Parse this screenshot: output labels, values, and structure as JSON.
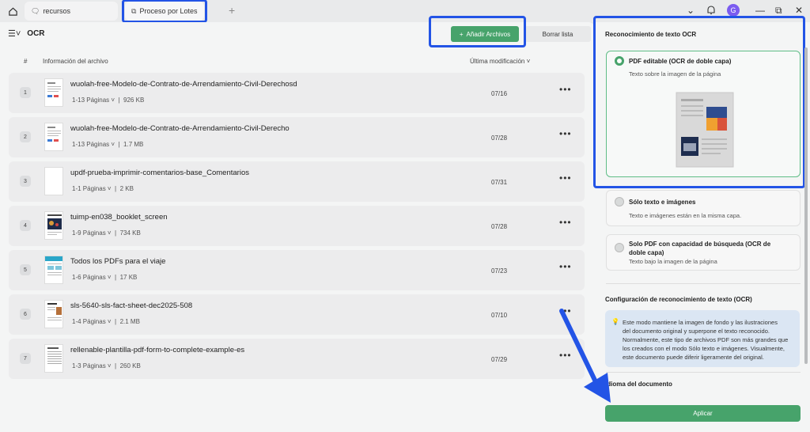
{
  "titlebar": {
    "tabs": [
      {
        "label": "recursos"
      },
      {
        "label": "Proceso por Lotes"
      }
    ],
    "avatar_letter": "G"
  },
  "toolbar": {
    "title": "OCR",
    "add_files": "Añadir Archivos",
    "clear_list": "Borrar lista"
  },
  "columns": {
    "number": "#",
    "info": "Información del archivo",
    "modified": "Última modificación"
  },
  "files": [
    {
      "num": "1",
      "name": "wuolah-free-Modelo-de-Contrato-de-Arrendamiento-Civil-Derechosd",
      "pages": "1-13 Páginas",
      "size": "926 KB",
      "date": "07/16"
    },
    {
      "num": "2",
      "name": "wuolah-free-Modelo-de-Contrato-de-Arrendamiento-Civil-Derecho",
      "pages": "1-13 Páginas",
      "size": "1.7 MB",
      "date": "07/28"
    },
    {
      "num": "3",
      "name": "updf-prueba-imprimir-comentarios-base_Comentarios",
      "pages": "1-1 Páginas",
      "size": "2 KB",
      "date": "07/31"
    },
    {
      "num": "4",
      "name": "tuimp-en038_booklet_screen",
      "pages": "1-9 Páginas",
      "size": "734 KB",
      "date": "07/28"
    },
    {
      "num": "5",
      "name": "Todos los PDFs para el viaje",
      "pages": "1-6 Páginas",
      "size": "17 KB",
      "date": "07/23"
    },
    {
      "num": "6",
      "name": "sls-5640-sls-fact-sheet-dec2025-508",
      "pages": "1-4 Páginas",
      "size": "2.1 MB",
      "date": "07/10"
    },
    {
      "num": "7",
      "name": "rellenable-plantilla-pdf-form-to-complete-example-es",
      "pages": "1-3 Páginas",
      "size": "260 KB",
      "date": "07/29"
    }
  ],
  "sidebar": {
    "section1": "Reconocimiento de texto OCR",
    "options": [
      {
        "title": "PDF editable (OCR de doble capa)",
        "sub": "Texto sobre la imagen de la página"
      },
      {
        "title": "Sólo texto e imágenes",
        "sub": "Texto e imágenes están en la misma capa."
      },
      {
        "title": "Solo PDF con capacidad de búsqueda (OCR de",
        "title2": "doble capa)",
        "sub": "Texto bajo la imagen de la página"
      }
    ],
    "section2": "Configuración de reconocimiento de texto (OCR)",
    "info_lines": [
      "Este modo mantiene la imagen de fondo y las ilustraciones",
      "del documento original y superpone el texto reconocido.",
      "Normalmente, este tipo de archivos PDF son más grandes que",
      "los creados con el modo Sólo texto e imágenes. Visualmente,",
      "este documento puede diferir ligeramente del original."
    ],
    "section3": "Idioma del documento",
    "apply": "Aplicar"
  },
  "colors": {
    "accent_green": "#47a36b",
    "highlight_blue": "#2354e6",
    "info_bg": "#dbe6f3"
  }
}
